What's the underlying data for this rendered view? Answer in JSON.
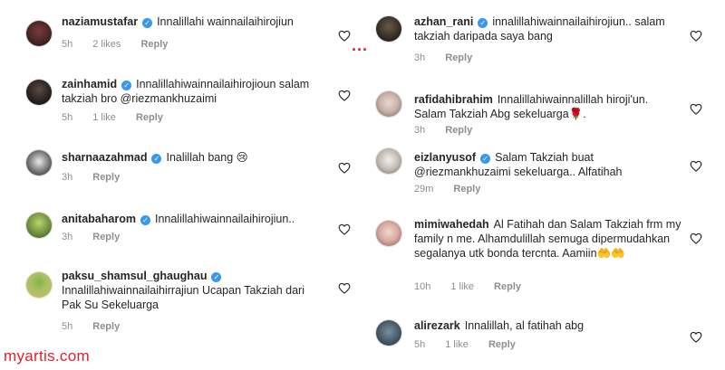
{
  "colors": {
    "verified": "#3897f0",
    "meta_text": "#8e8e8e",
    "watermark": "#e0202a"
  },
  "left_comments": [
    {
      "username": "naziamustafar",
      "verified": true,
      "text": "Innalillahi wainnailaihirojiun",
      "time": "5h",
      "likes": "2 likes",
      "reply": "Reply"
    },
    {
      "username": "zainhamid",
      "verified": true,
      "text": "Innalillahiwainnailaihirojioun salam takziah bro @riezmankhuzaimi",
      "time": "5h",
      "likes": "1 like",
      "reply": "Reply"
    },
    {
      "username": "sharnaazahmad",
      "verified": true,
      "text": "Inalillah bang 😢",
      "time": "3h",
      "likes": "",
      "reply": "Reply"
    },
    {
      "username": "anitabaharom",
      "verified": true,
      "text": "Innalillahiwainnailaihirojiun..",
      "time": "3h",
      "likes": "",
      "reply": "Reply"
    },
    {
      "username": "paksu_shamsul_ghaughau",
      "verified": true,
      "text": "Innalillahiwainnailaihirrajiun Ucapan Takziah dari Pak Su Sekeluarga",
      "time": "5h",
      "likes": "",
      "reply": "Reply"
    }
  ],
  "right_comments": [
    {
      "username": "azhan_rani",
      "verified": true,
      "text": "innalillahiwainnailaihirojiun.. salam takziah daripada saya bang",
      "time": "3h",
      "likes": "",
      "reply": "Reply"
    },
    {
      "username": "rafidahibrahim",
      "verified": false,
      "text": "Innalillahiwainnalillah hiroji'un. Salam Takziah Abg sekeluarga🌹.",
      "time": "3h",
      "likes": "",
      "reply": "Reply"
    },
    {
      "username": "eizlanyusof",
      "verified": true,
      "text": "Salam Takziah buat @riezmankhuzaimi sekeluarga.. Alfatihah",
      "time": "29m",
      "likes": "",
      "reply": "Reply"
    },
    {
      "username": "mimiwahedah",
      "verified": false,
      "text": "Al Fatihah dan Salam Takziah frm my family n me. Alhamdulillah semuga dipermudahkan segalanya utk bonda tercnta. Aamiin🤲🤲",
      "time": "10h",
      "likes": "1 like",
      "reply": "Reply"
    },
    {
      "username": "alirezark",
      "verified": false,
      "text": "Innalillah, al fatihah abg",
      "time": "5h",
      "likes": "1 like",
      "reply": "Reply"
    }
  ],
  "icons": {
    "heart": "heart-icon",
    "verified": "verified-badge-icon"
  },
  "watermark": "myartis.com",
  "dots": "..."
}
